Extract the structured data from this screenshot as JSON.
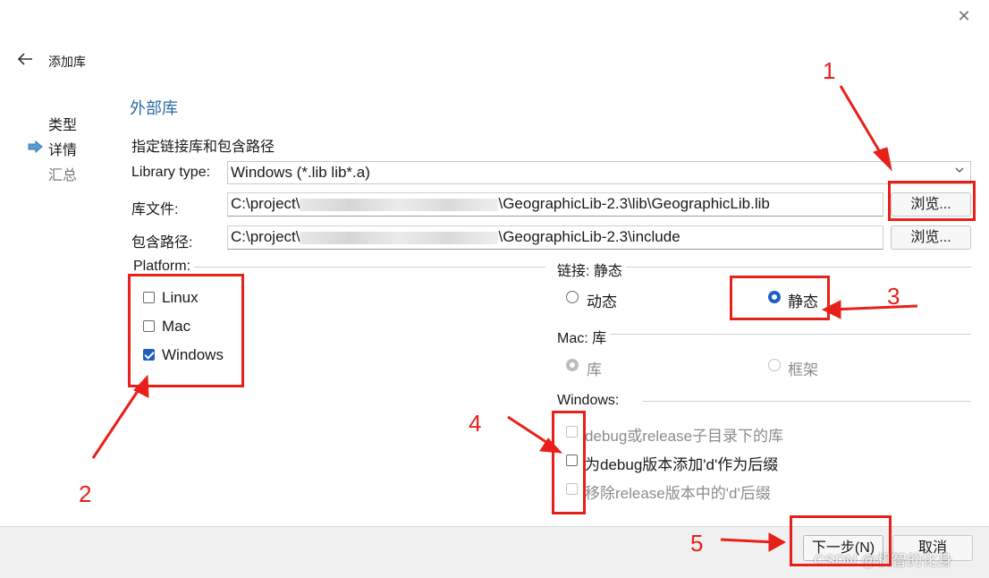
{
  "window": {
    "close_glyph": "✕"
  },
  "wizard": {
    "title": "添加库",
    "steps": [
      {
        "label": "类型",
        "state": "done"
      },
      {
        "label": "详情",
        "state": "current"
      },
      {
        "label": "汇总",
        "state": "pending"
      }
    ]
  },
  "page": {
    "section_title": "外部库",
    "subtitle": "指定链接库和包含路径",
    "library_type": {
      "label": "Library type:",
      "value": "Windows (*.lib lib*.a)"
    },
    "lib_file": {
      "label": "库文件:",
      "value_prefix": "C:\\project\\",
      "value_suffix": "\\GeographicLib-2.3\\lib\\GeographicLib.lib",
      "browse_label": "浏览..."
    },
    "include_path": {
      "label": "包含路径:",
      "value_prefix": "C:\\project\\",
      "value_suffix": "\\GeographicLib-2.3\\include",
      "browse_label": "浏览..."
    },
    "platform": {
      "title": "Platform:",
      "options": [
        {
          "label": "Linux",
          "checked": false
        },
        {
          "label": "Mac",
          "checked": false
        },
        {
          "label": "Windows",
          "checked": true
        }
      ]
    },
    "linkage": {
      "title": "链接: 静态",
      "options": [
        {
          "label": "动态",
          "selected": false
        },
        {
          "label": "静态",
          "selected": true
        }
      ]
    },
    "mac": {
      "title": "Mac: 库",
      "options": [
        {
          "label": "库",
          "selected": true,
          "disabled": true
        },
        {
          "label": "框架",
          "selected": false,
          "disabled": true
        }
      ]
    },
    "windows": {
      "title": "Windows:",
      "options": [
        {
          "label": "debug或release子目录下的库",
          "checked": false,
          "disabled": true
        },
        {
          "label": "为debug版本添加'd'作为后缀",
          "checked": false,
          "disabled": false
        },
        {
          "label": "移除release版本中的'd'后缀",
          "checked": false,
          "disabled": true
        }
      ]
    }
  },
  "footer": {
    "next_label": "下一步(N)",
    "cancel_label": "取消"
  },
  "annotations": {
    "n1": "1",
    "n2": "2",
    "n3": "3",
    "n4": "4",
    "n5": "5"
  },
  "watermark": "CSDN @机智的化身",
  "colors": {
    "accent": "#1f5fbf",
    "annotation": "#e8201a",
    "section_title": "#2b6aa6"
  }
}
